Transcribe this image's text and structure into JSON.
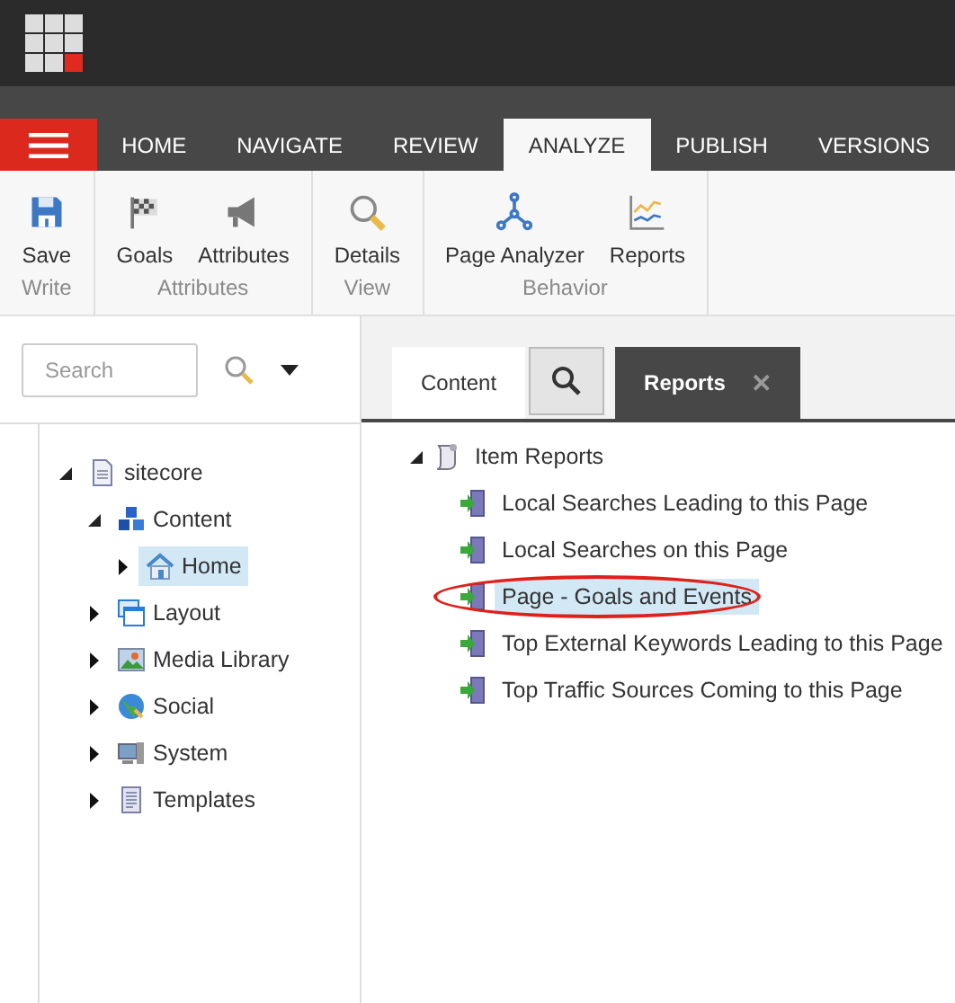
{
  "nav_tabs": [
    {
      "label": "HOME",
      "selected": false
    },
    {
      "label": "NAVIGATE",
      "selected": false
    },
    {
      "label": "REVIEW",
      "selected": false
    },
    {
      "label": "ANALYZE",
      "selected": true
    },
    {
      "label": "PUBLISH",
      "selected": false
    },
    {
      "label": "VERSIONS",
      "selected": false
    }
  ],
  "ribbon": {
    "groups": [
      {
        "label": "Write",
        "buttons": [
          {
            "label": "Save",
            "kind": "save"
          }
        ]
      },
      {
        "label": "Attributes",
        "buttons": [
          {
            "label": "Goals",
            "kind": "flag"
          },
          {
            "label": "Attributes",
            "kind": "megaphone"
          }
        ]
      },
      {
        "label": "View",
        "buttons": [
          {
            "label": "Details",
            "kind": "magnifier"
          }
        ]
      },
      {
        "label": "Behavior",
        "buttons": [
          {
            "label": "Page Analyzer",
            "kind": "network"
          },
          {
            "label": "Reports",
            "kind": "chart"
          }
        ]
      }
    ]
  },
  "search": {
    "placeholder": "Search"
  },
  "content_tree": [
    {
      "label": "sitecore",
      "kind": "document",
      "expanded": true,
      "selected": false,
      "children": [
        {
          "label": "Content",
          "kind": "content",
          "expanded": true,
          "selected": false,
          "children": [
            {
              "label": "Home",
              "kind": "home",
              "expanded": false,
              "selected": true
            }
          ]
        },
        {
          "label": "Layout",
          "kind": "layout",
          "expanded": false,
          "selected": false
        },
        {
          "label": "Media Library",
          "kind": "media",
          "expanded": false,
          "selected": false
        },
        {
          "label": "Social",
          "kind": "social",
          "expanded": false,
          "selected": false
        },
        {
          "label": "System",
          "kind": "system",
          "expanded": false,
          "selected": false
        },
        {
          "label": "Templates",
          "kind": "templates",
          "expanded": false,
          "selected": false
        }
      ]
    }
  ],
  "editor_tabs": [
    {
      "kind": "text",
      "label": "Content",
      "selected": false
    },
    {
      "kind": "search",
      "selected": false
    },
    {
      "kind": "text",
      "label": "Reports",
      "selected": true,
      "closable": true
    }
  ],
  "reports_tree": {
    "label": "Item Reports",
    "expanded": true,
    "children": [
      {
        "label": "Local Searches Leading to this Page",
        "selected": false,
        "circled": false
      },
      {
        "label": "Local Searches on this Page",
        "selected": false,
        "circled": false
      },
      {
        "label": "Page - Goals and Events",
        "selected": true,
        "circled": true
      },
      {
        "label": "Top External Keywords Leading to this Page",
        "selected": false,
        "circled": false
      },
      {
        "label": "Top Traffic Sources Coming to this Page",
        "selected": false,
        "circled": false
      }
    ]
  },
  "close_icon": "✕"
}
